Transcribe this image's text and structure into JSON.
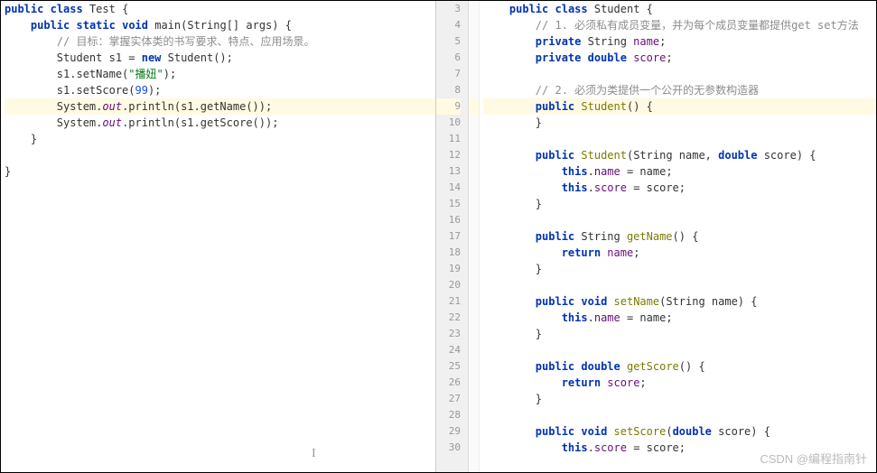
{
  "left": {
    "lines": [
      {
        "indent": 0,
        "tokens": [
          {
            "t": "public",
            "c": "k-public"
          },
          {
            "t": " "
          },
          {
            "t": "class",
            "c": "k-class"
          },
          {
            "t": " Test {"
          }
        ]
      },
      {
        "indent": 4,
        "tokens": [
          {
            "t": "public",
            "c": "k-public"
          },
          {
            "t": " "
          },
          {
            "t": "static",
            "c": "k-static"
          },
          {
            "t": " "
          },
          {
            "t": "void",
            "c": "k-void"
          },
          {
            "t": " main(String[] args) {"
          }
        ]
      },
      {
        "indent": 8,
        "tokens": [
          {
            "t": "// 目标：掌握实体类的书写要求、特点、应用场景。",
            "c": "comment"
          }
        ]
      },
      {
        "indent": 8,
        "tokens": [
          {
            "t": "Student s1 = "
          },
          {
            "t": "new",
            "c": "k-new"
          },
          {
            "t": " Student();"
          }
        ]
      },
      {
        "indent": 8,
        "tokens": [
          {
            "t": "s1.setName("
          },
          {
            "t": "\"播妞\"",
            "c": "string"
          },
          {
            "t": ");"
          }
        ]
      },
      {
        "indent": 8,
        "tokens": [
          {
            "t": "s1.setScore("
          },
          {
            "t": "99",
            "c": "num"
          },
          {
            "t": ");"
          }
        ]
      },
      {
        "indent": 8,
        "hl": true,
        "tokens": [
          {
            "t": "System."
          },
          {
            "t": "out",
            "c": "out"
          },
          {
            "t": ".println(s1.getName());"
          }
        ]
      },
      {
        "indent": 8,
        "tokens": [
          {
            "t": "System."
          },
          {
            "t": "out",
            "c": "out"
          },
          {
            "t": ".println(s1.getScore());"
          }
        ]
      },
      {
        "indent": 4,
        "tokens": [
          {
            "t": "}"
          }
        ]
      },
      {
        "indent": 0,
        "tokens": [
          {
            "t": ""
          }
        ]
      },
      {
        "indent": 0,
        "tokens": [
          {
            "t": "}"
          }
        ]
      }
    ]
  },
  "right": {
    "startLine": 3,
    "lines": [
      {
        "n": 3,
        "indent": 4,
        "tokens": [
          {
            "t": "public",
            "c": "k-public"
          },
          {
            "t": " "
          },
          {
            "t": "class",
            "c": "k-class"
          },
          {
            "t": " Student {"
          }
        ]
      },
      {
        "n": 4,
        "indent": 8,
        "tokens": [
          {
            "t": "// 1. 必须私有成员变量，并为每个成员变量都提供get set方法",
            "c": "comment"
          }
        ]
      },
      {
        "n": 5,
        "indent": 8,
        "tokens": [
          {
            "t": "private",
            "c": "k-private"
          },
          {
            "t": " String "
          },
          {
            "t": "name",
            "c": "field"
          },
          {
            "t": ";"
          }
        ]
      },
      {
        "n": 6,
        "indent": 8,
        "tokens": [
          {
            "t": "private",
            "c": "k-private"
          },
          {
            "t": " "
          },
          {
            "t": "double",
            "c": "k-double"
          },
          {
            "t": " "
          },
          {
            "t": "score",
            "c": "field"
          },
          {
            "t": ";"
          }
        ]
      },
      {
        "n": 7,
        "indent": 8,
        "tokens": []
      },
      {
        "n": 8,
        "indent": 8,
        "tokens": [
          {
            "t": "// 2. 必须为类提供一个公开的无参数构造器",
            "c": "comment"
          }
        ]
      },
      {
        "n": 9,
        "indent": 8,
        "hl": true,
        "tokens": [
          {
            "t": "public",
            "c": "k-public"
          },
          {
            "t": " "
          },
          {
            "t": "Student",
            "c": "method-decl"
          },
          {
            "t": "() {"
          }
        ]
      },
      {
        "n": 10,
        "indent": 8,
        "tokens": [
          {
            "t": "}"
          }
        ]
      },
      {
        "n": 11,
        "indent": 8,
        "tokens": []
      },
      {
        "n": 12,
        "indent": 8,
        "tokens": [
          {
            "t": "public",
            "c": "k-public"
          },
          {
            "t": " "
          },
          {
            "t": "Student",
            "c": "method-decl"
          },
          {
            "t": "(String name, "
          },
          {
            "t": "double",
            "c": "k-double"
          },
          {
            "t": " score) {"
          }
        ]
      },
      {
        "n": 13,
        "indent": 12,
        "tokens": [
          {
            "t": "this",
            "c": "k-this"
          },
          {
            "t": "."
          },
          {
            "t": "name",
            "c": "field"
          },
          {
            "t": " = name;"
          }
        ]
      },
      {
        "n": 14,
        "indent": 12,
        "tokens": [
          {
            "t": "this",
            "c": "k-this"
          },
          {
            "t": "."
          },
          {
            "t": "score",
            "c": "field"
          },
          {
            "t": " = score;"
          }
        ]
      },
      {
        "n": 15,
        "indent": 8,
        "tokens": [
          {
            "t": "}"
          }
        ]
      },
      {
        "n": 16,
        "indent": 8,
        "tokens": []
      },
      {
        "n": 17,
        "indent": 8,
        "tokens": [
          {
            "t": "public",
            "c": "k-public"
          },
          {
            "t": " String "
          },
          {
            "t": "getName",
            "c": "method-decl"
          },
          {
            "t": "() {"
          }
        ]
      },
      {
        "n": 18,
        "indent": 12,
        "tokens": [
          {
            "t": "return",
            "c": "k-return"
          },
          {
            "t": " "
          },
          {
            "t": "name",
            "c": "field"
          },
          {
            "t": ";"
          }
        ]
      },
      {
        "n": 19,
        "indent": 8,
        "tokens": [
          {
            "t": "}"
          }
        ]
      },
      {
        "n": 20,
        "indent": 8,
        "tokens": []
      },
      {
        "n": 21,
        "indent": 8,
        "tokens": [
          {
            "t": "public",
            "c": "k-public"
          },
          {
            "t": " "
          },
          {
            "t": "void",
            "c": "k-void"
          },
          {
            "t": " "
          },
          {
            "t": "setName",
            "c": "method-decl"
          },
          {
            "t": "(String name) {"
          }
        ]
      },
      {
        "n": 22,
        "indent": 12,
        "tokens": [
          {
            "t": "this",
            "c": "k-this"
          },
          {
            "t": "."
          },
          {
            "t": "name",
            "c": "field"
          },
          {
            "t": " = name;"
          }
        ]
      },
      {
        "n": 23,
        "indent": 8,
        "tokens": [
          {
            "t": "}"
          }
        ]
      },
      {
        "n": 24,
        "indent": 8,
        "tokens": []
      },
      {
        "n": 25,
        "indent": 8,
        "tokens": [
          {
            "t": "public",
            "c": "k-public"
          },
          {
            "t": " "
          },
          {
            "t": "double",
            "c": "k-double"
          },
          {
            "t": " "
          },
          {
            "t": "getScore",
            "c": "method-decl"
          },
          {
            "t": "() {"
          }
        ]
      },
      {
        "n": 26,
        "indent": 12,
        "tokens": [
          {
            "t": "return",
            "c": "k-return"
          },
          {
            "t": " "
          },
          {
            "t": "score",
            "c": "field"
          },
          {
            "t": ";"
          }
        ]
      },
      {
        "n": 27,
        "indent": 8,
        "tokens": [
          {
            "t": "}"
          }
        ]
      },
      {
        "n": 28,
        "indent": 8,
        "tokens": []
      },
      {
        "n": 29,
        "indent": 8,
        "tokens": [
          {
            "t": "public",
            "c": "k-public"
          },
          {
            "t": " "
          },
          {
            "t": "void",
            "c": "k-void"
          },
          {
            "t": " "
          },
          {
            "t": "setScore",
            "c": "method-decl"
          },
          {
            "t": "("
          },
          {
            "t": "double",
            "c": "k-double"
          },
          {
            "t": " score) {"
          }
        ]
      },
      {
        "n": 30,
        "indent": 12,
        "tokens": [
          {
            "t": "this",
            "c": "k-this"
          },
          {
            "t": "."
          },
          {
            "t": "score",
            "c": "field"
          },
          {
            "t": " = score;"
          }
        ]
      }
    ]
  },
  "watermark": "CSDN @编程指南针"
}
